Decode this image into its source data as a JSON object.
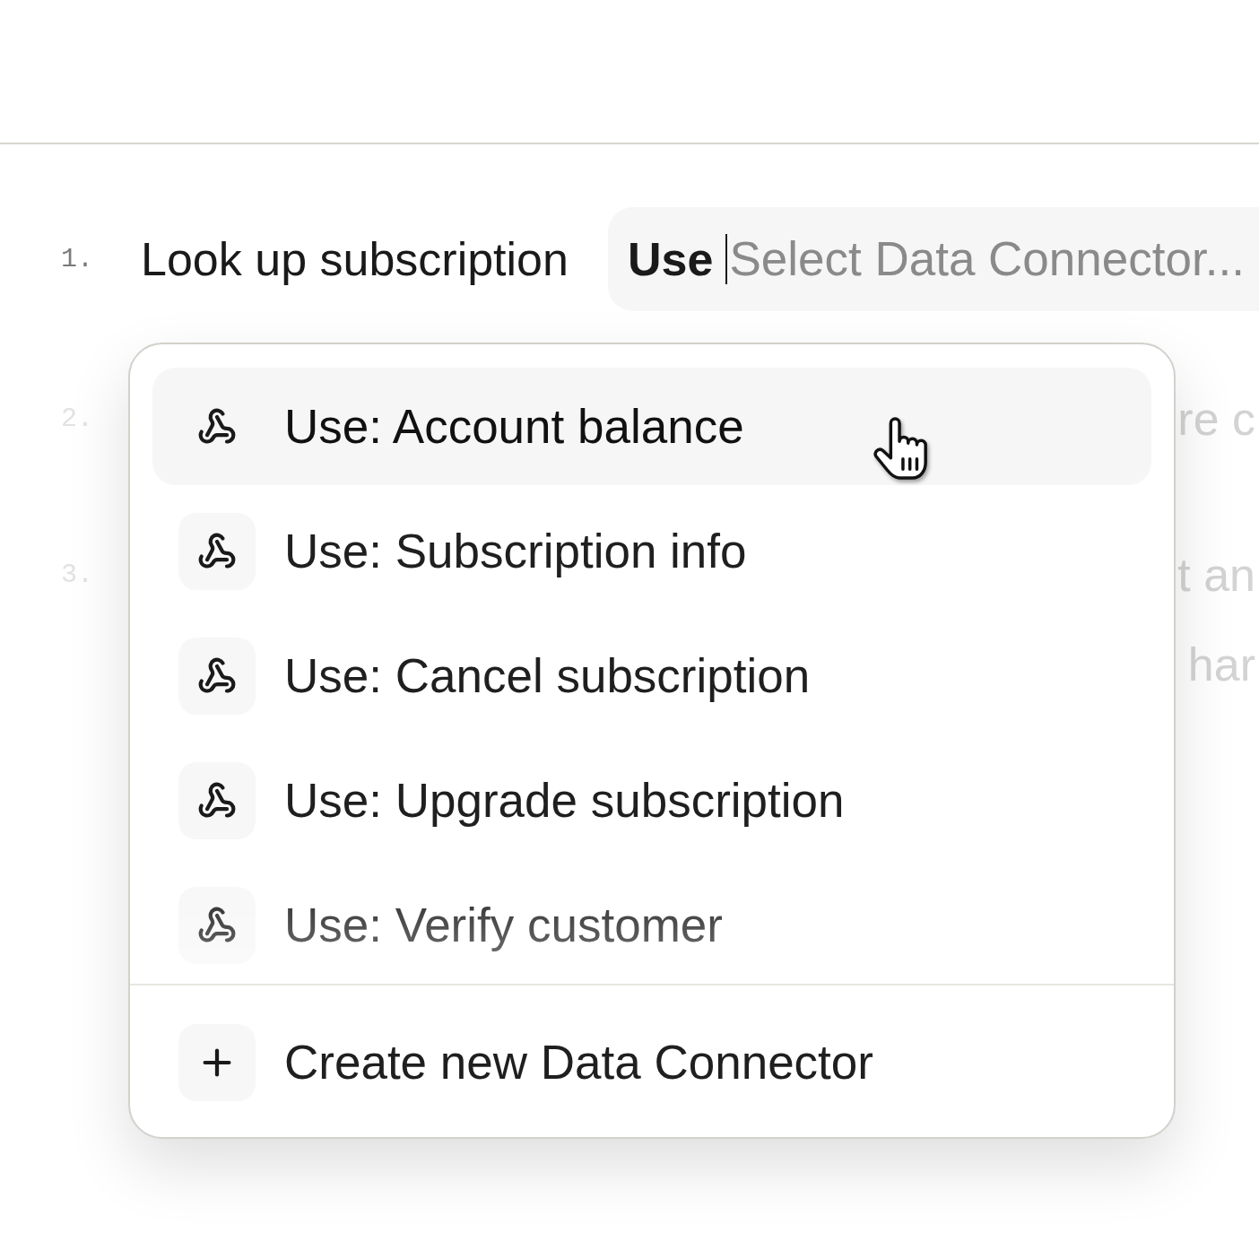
{
  "steps": [
    {
      "number": "1.",
      "dimmed": false,
      "text": "Look up subscription",
      "connector_field": {
        "prefix": "Use",
        "placeholder": "Select Data Connector..."
      }
    },
    {
      "number": "2.",
      "dimmed": true,
      "visible_fragments": [
        "re c"
      ]
    },
    {
      "number": "3.",
      "dimmed": true,
      "visible_fragments": [
        "t an",
        "har"
      ]
    }
  ],
  "dropdown": {
    "options": [
      {
        "label": "Use: Account balance",
        "selected": true
      },
      {
        "label": "Use: Subscription info",
        "selected": false
      },
      {
        "label": "Use: Cancel subscription",
        "selected": false
      },
      {
        "label": "Use: Upgrade subscription",
        "selected": false
      },
      {
        "label": "Use: Verify customer",
        "selected": false
      }
    ],
    "create_action": {
      "label": "Create new Data Connector"
    }
  }
}
